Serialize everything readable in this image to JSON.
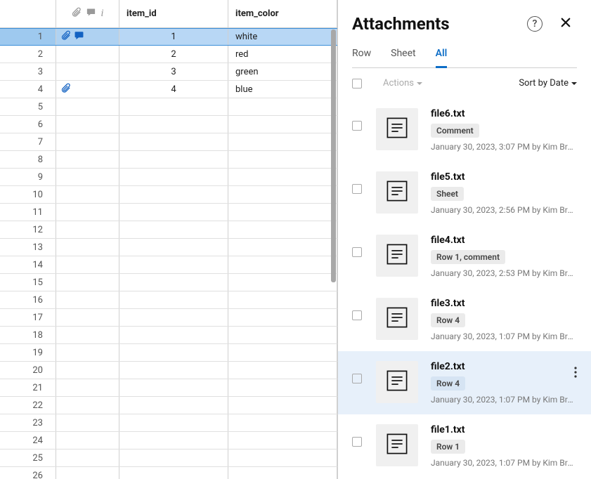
{
  "spreadsheet": {
    "columns": [
      "item_id",
      "item_color"
    ],
    "rows": [
      {
        "num": 1,
        "hasAttachment": true,
        "hasComment": true,
        "item_id": "1",
        "item_color": "white",
        "selected": true
      },
      {
        "num": 2,
        "hasAttachment": false,
        "hasComment": false,
        "item_id": "2",
        "item_color": "red",
        "selected": false
      },
      {
        "num": 3,
        "hasAttachment": false,
        "hasComment": false,
        "item_id": "3",
        "item_color": "green",
        "selected": false
      },
      {
        "num": 4,
        "hasAttachment": true,
        "hasComment": false,
        "item_id": "4",
        "item_color": "blue",
        "selected": false
      }
    ],
    "emptyRowStart": 5,
    "emptyRowEnd": 26
  },
  "panel": {
    "title": "Attachments",
    "tabs": [
      {
        "label": "Row",
        "active": false
      },
      {
        "label": "Sheet",
        "active": false
      },
      {
        "label": "All",
        "active": true
      }
    ],
    "actionsLabel": "Actions",
    "sortLabel": "Sort by Date",
    "attachments": [
      {
        "name": "file6.txt",
        "badge": "Comment",
        "meta": "January 30, 2023, 3:07 PM by Kim Bra...",
        "hover": false
      },
      {
        "name": "file5.txt",
        "badge": "Sheet",
        "meta": "January 30, 2023, 2:56 PM by Kim Bra...",
        "hover": false
      },
      {
        "name": "file4.txt",
        "badge": "Row 1, comment",
        "meta": "January 30, 2023, 2:53 PM by Kim Bra...",
        "hover": false
      },
      {
        "name": "file3.txt",
        "badge": "Row 4",
        "meta": "January 30, 2023, 1:07 PM by Kim Bra...",
        "hover": false
      },
      {
        "name": "file2.txt",
        "badge": "Row 4",
        "meta": "January 30, 2023, 1:07 PM by Kim Bra...",
        "hover": true
      },
      {
        "name": "file1.txt",
        "badge": "Row 1",
        "meta": "January 30, 2023, 1:07 PM by Kim Bra...",
        "hover": false
      }
    ]
  }
}
